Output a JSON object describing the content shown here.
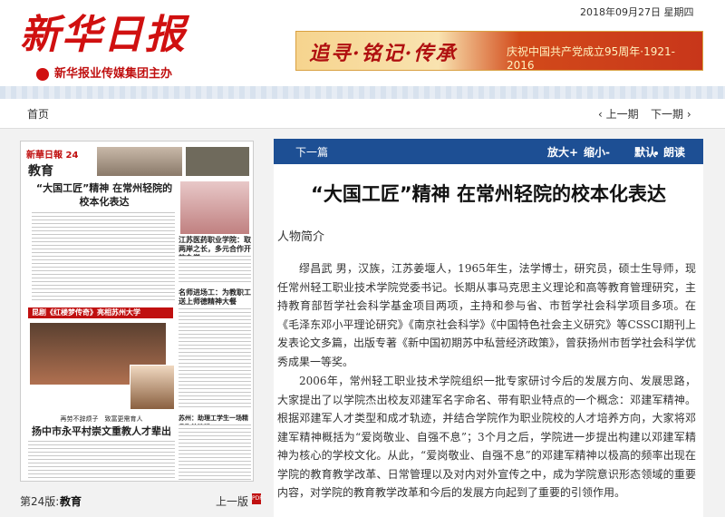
{
  "header": {
    "logo": "新华日报",
    "sub": "新华报业传媒集团主办",
    "date": "2018年09月27日 星期四",
    "banner_main": "追寻·铭记·传承",
    "banner_sub": "庆祝中国共产党成立95周年·1921-2016"
  },
  "nav": {
    "home": "首页",
    "prev_issue": "上一期",
    "next_issue": "下一期"
  },
  "thumbnail": {
    "masthead": "新華日報 24",
    "section": "教育",
    "headline1": "“大国工匠”精神 在常州轻院的校本化表达",
    "headline2": "江苏医药职业学院：取两岸之长，多元合作开放办学",
    "headline3": "名师进场工：为教职工送上师德精神大餐",
    "redbar": "昆剧《红楼梦传奇》亮相苏州大学",
    "headline4_small": "再劳不辞烦子　致富更需育人",
    "headline4": "扬中市永平村崇文重教人才辈出",
    "headline5": "苏州：助理工学生一场精品陶韵演讲"
  },
  "pagebar": {
    "number": "第24版:",
    "name": "教育",
    "prev_page": "上一版",
    "pdf": "PDF"
  },
  "toolbar": {
    "next": "下一篇",
    "enlarge": "放大+",
    "shrink": "缩小-",
    "default": "默认",
    "read": "朗读"
  },
  "article": {
    "title": "“大国工匠”精神 在常州轻院的校本化表达",
    "subhead": "人物简介",
    "para1": "缪昌武 男，汉族，江苏姜堰人，1965年生，法学博士，研究员，硕士生导师，现任常州轻工职业技术学院党委书记。长期从事马克思主义理论和高等教育管理研究，主持教育部哲学社会科学基金项目两项，主持和参与省、市哲学社会科学项目多项。在《毛泽东邓小平理论研究》《南京社会科学》《中国特色社会主义研究》等CSSCI期刊上发表论文多篇，出版专著《新中国初期苏中私营经济政策》，曾获扬州市哲学社会科学优秀成果一等奖。",
    "para2": "2006年，常州轻工职业技术学院组织一批专家研讨今后的发展方向、发展思路，大家提出了以学院杰出校友邓建军名字命名、带有职业特点的一个概念：邓建军精神。根据邓建军人才类型和成才轨迹，并结合学院作为职业院校的人才培养方向，大家将邓建军精神概括为“爱岗敬业、自强不息”；3个月之后，学院进一步提出构建以邓建军精神为核心的学校文化。从此，“爱岗敬业、自强不息”的邓建军精神以极高的频率出现在学院的教育教学改革、日常管理以及对内对外宣传之中，成为学院意识形态领域的重要内容，对学院的教育教学改革和今后的发展方向起到了重要的引领作用。"
  }
}
